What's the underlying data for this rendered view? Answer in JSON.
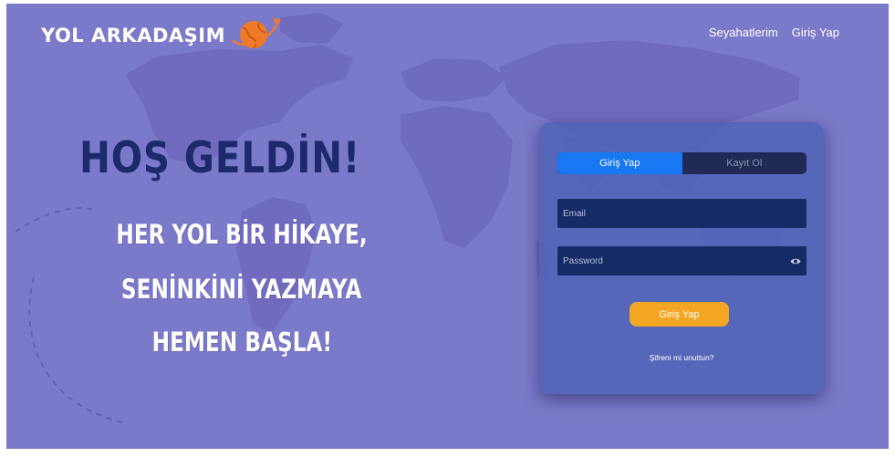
{
  "brand": {
    "name": "YOL ARKADAŞIM",
    "logo_icon": "globe-plane-icon",
    "accent": "#ef7a2a"
  },
  "nav": {
    "items": [
      "Seyahatlerim",
      "Giriş Yap"
    ]
  },
  "hero": {
    "title": "HOŞ GELDİN!",
    "lines": [
      "HER YOL BİR HİKAYE,",
      "SENİNKİNİ YAZMAYA",
      "HEMEN BAŞLA!"
    ]
  },
  "login": {
    "tabs": [
      {
        "label": "Giriş Yap",
        "active": true
      },
      {
        "label": "Kayıt Ol",
        "active": false
      }
    ],
    "email_placeholder": "Email",
    "password_placeholder": "Password",
    "password_toggle_icon": "eye-icon",
    "submit_label": "Giriş Yap",
    "forgot_label": "Şifreni mi unuttun?"
  },
  "colors": {
    "background": "#7b79c9",
    "title": "#1c2a6b",
    "primary": "#1877f2",
    "button": "#f4a622",
    "field": "#152b66"
  }
}
